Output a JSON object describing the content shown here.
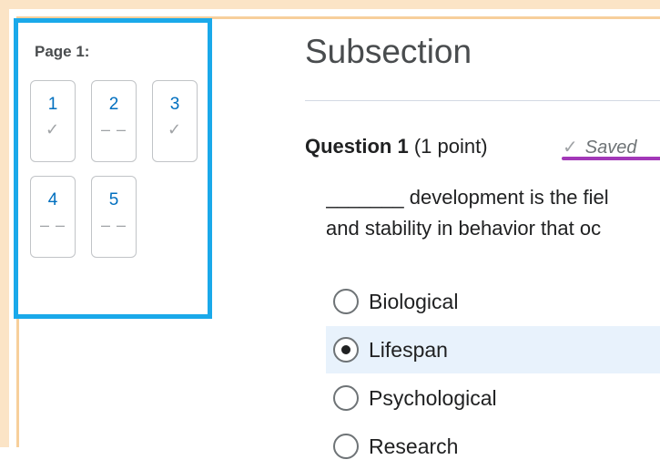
{
  "nav": {
    "title": "Page 1:",
    "questions": [
      {
        "number": "1",
        "status_icon": "check-icon",
        "status_text": "✓"
      },
      {
        "number": "2",
        "status_icon": "dash-icon",
        "status_text": "– –"
      },
      {
        "number": "3",
        "status_icon": "check-icon",
        "status_text": "✓"
      },
      {
        "number": "4",
        "status_icon": "dash-icon",
        "status_text": "– –"
      },
      {
        "number": "5",
        "status_icon": "dash-icon",
        "status_text": "– –"
      }
    ]
  },
  "section": {
    "title": "Subsection"
  },
  "question": {
    "label": "Question 1",
    "points": "(1 point)",
    "saved_text": "Saved",
    "text_line1": "_______ development is the fiel",
    "text_line2": "and stability in behavior that oc",
    "options": [
      {
        "label": "Biological",
        "selected": false
      },
      {
        "label": "Lifespan",
        "selected": true
      },
      {
        "label": "Psychological",
        "selected": false
      },
      {
        "label": "Research",
        "selected": false
      }
    ]
  },
  "colors": {
    "highlight_frame": "#1aa9ea",
    "saved_underline": "#a238b8",
    "selected_option_bg": "#e8f2fc",
    "link_number": "#006fbf"
  }
}
